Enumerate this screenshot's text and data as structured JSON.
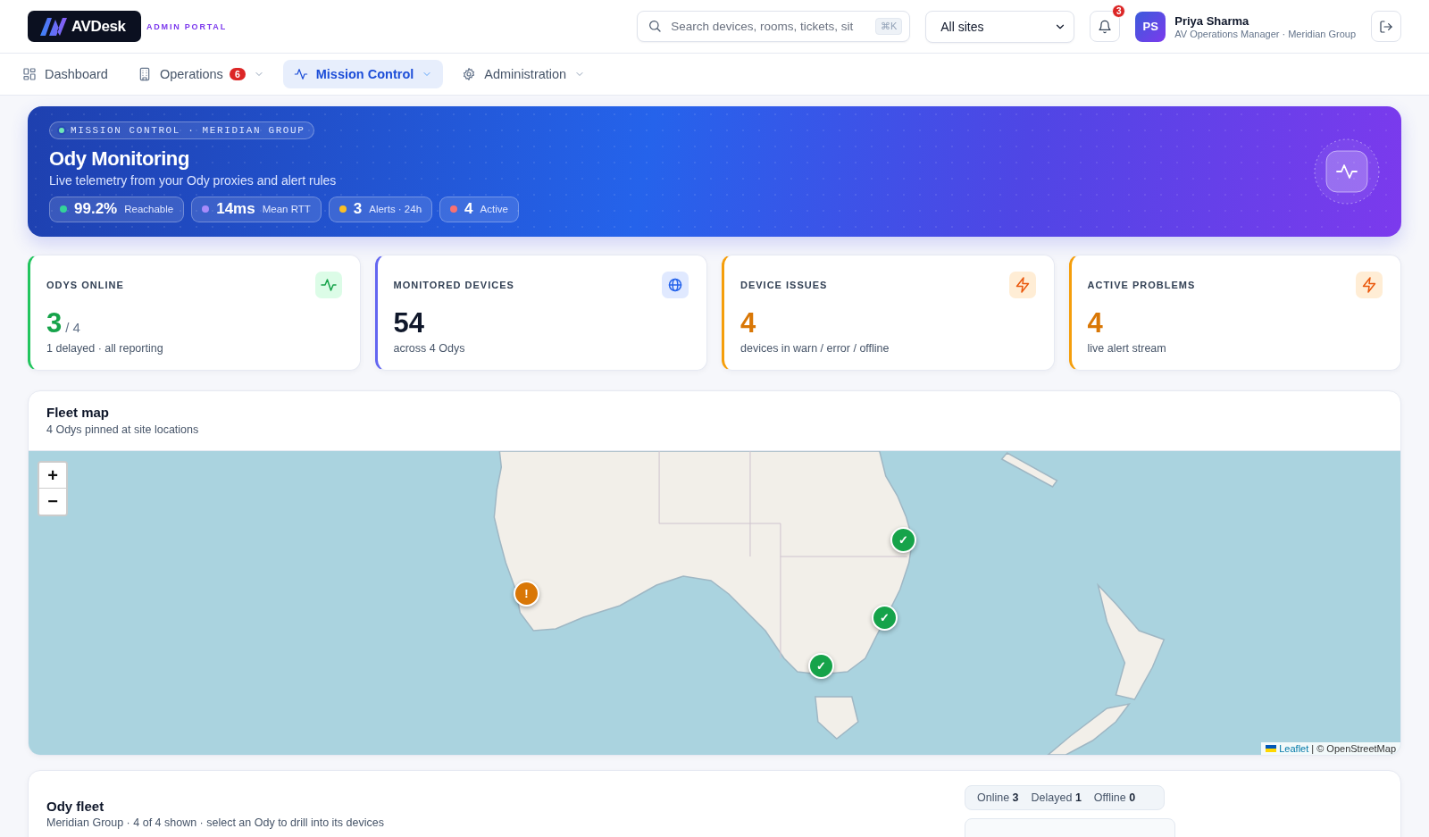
{
  "header": {
    "logo": {
      "text": "AVDesk"
    },
    "portal_label": "ADMIN PORTAL",
    "search": {
      "placeholder": "Search devices, rooms, tickets, sit",
      "shortcut": "⌘K"
    },
    "site_select": {
      "value": "All sites"
    },
    "notifications": {
      "count": "3"
    },
    "user": {
      "initials": "PS",
      "name": "Priya Sharma",
      "role": "AV Operations Manager · Meridian Group"
    }
  },
  "nav": {
    "items": [
      {
        "label": "Dashboard",
        "selected": false,
        "dropdown": false
      },
      {
        "label": "Operations",
        "badge": "6",
        "selected": false,
        "dropdown": true
      },
      {
        "label": "Mission Control",
        "selected": true,
        "dropdown": true
      },
      {
        "label": "Administration",
        "selected": false,
        "dropdown": true
      }
    ]
  },
  "hero": {
    "eyebrow": "MISSION CONTROL · MERIDIAN GROUP",
    "title": "Ody Monitoring",
    "subtitle": "Live telemetry from your Ody proxies and alert rules",
    "stats": [
      {
        "value": "99.2%",
        "label": "Reachable",
        "color": "#34d399"
      },
      {
        "value": "14ms",
        "label": "Mean RTT",
        "color": "#a78bfa"
      },
      {
        "value": "3",
        "label": "Alerts · 24h",
        "color": "#fbbf24"
      },
      {
        "value": "4",
        "label": "Active",
        "color": "#f87171"
      }
    ]
  },
  "kpis": [
    {
      "kind": "success",
      "label": "ODYS ONLINE",
      "value": "3",
      "total": "/ 4",
      "note": "1 delayed · all reporting"
    },
    {
      "kind": "info",
      "label": "MONITORED DEVICES",
      "value": "54",
      "note": "across 4 Odys"
    },
    {
      "kind": "warning",
      "label": "DEVICE ISSUES",
      "value": "4",
      "note": "devices in warn / error / offline"
    },
    {
      "kind": "warning",
      "label": "ACTIVE PROBLEMS",
      "value": "4",
      "note": "live alert stream"
    }
  ],
  "fleet_map": {
    "title": "Fleet map",
    "subtitle": "4 Odys pinned at site locations",
    "zoom_in": "+",
    "zoom_out": "−",
    "markers": [
      {
        "glyph": "✓",
        "color": "#16a34a"
      },
      {
        "glyph": "!",
        "color": "#d97706"
      },
      {
        "glyph": "✓",
        "color": "#16a34a"
      },
      {
        "glyph": "✓",
        "color": "#16a34a"
      }
    ],
    "attribution": {
      "link": "Leaflet",
      "text": "| © OpenStreetMap"
    }
  },
  "ody_fleet": {
    "title": "Ody fleet",
    "subtitle": "Meridian Group · 4 of 4 shown · select an Ody to drill into its devices",
    "status_filters": [
      {
        "label": "Online",
        "count": "3"
      },
      {
        "label": "Delayed",
        "count": "1"
      },
      {
        "label": "Offline",
        "count": "0"
      }
    ]
  }
}
